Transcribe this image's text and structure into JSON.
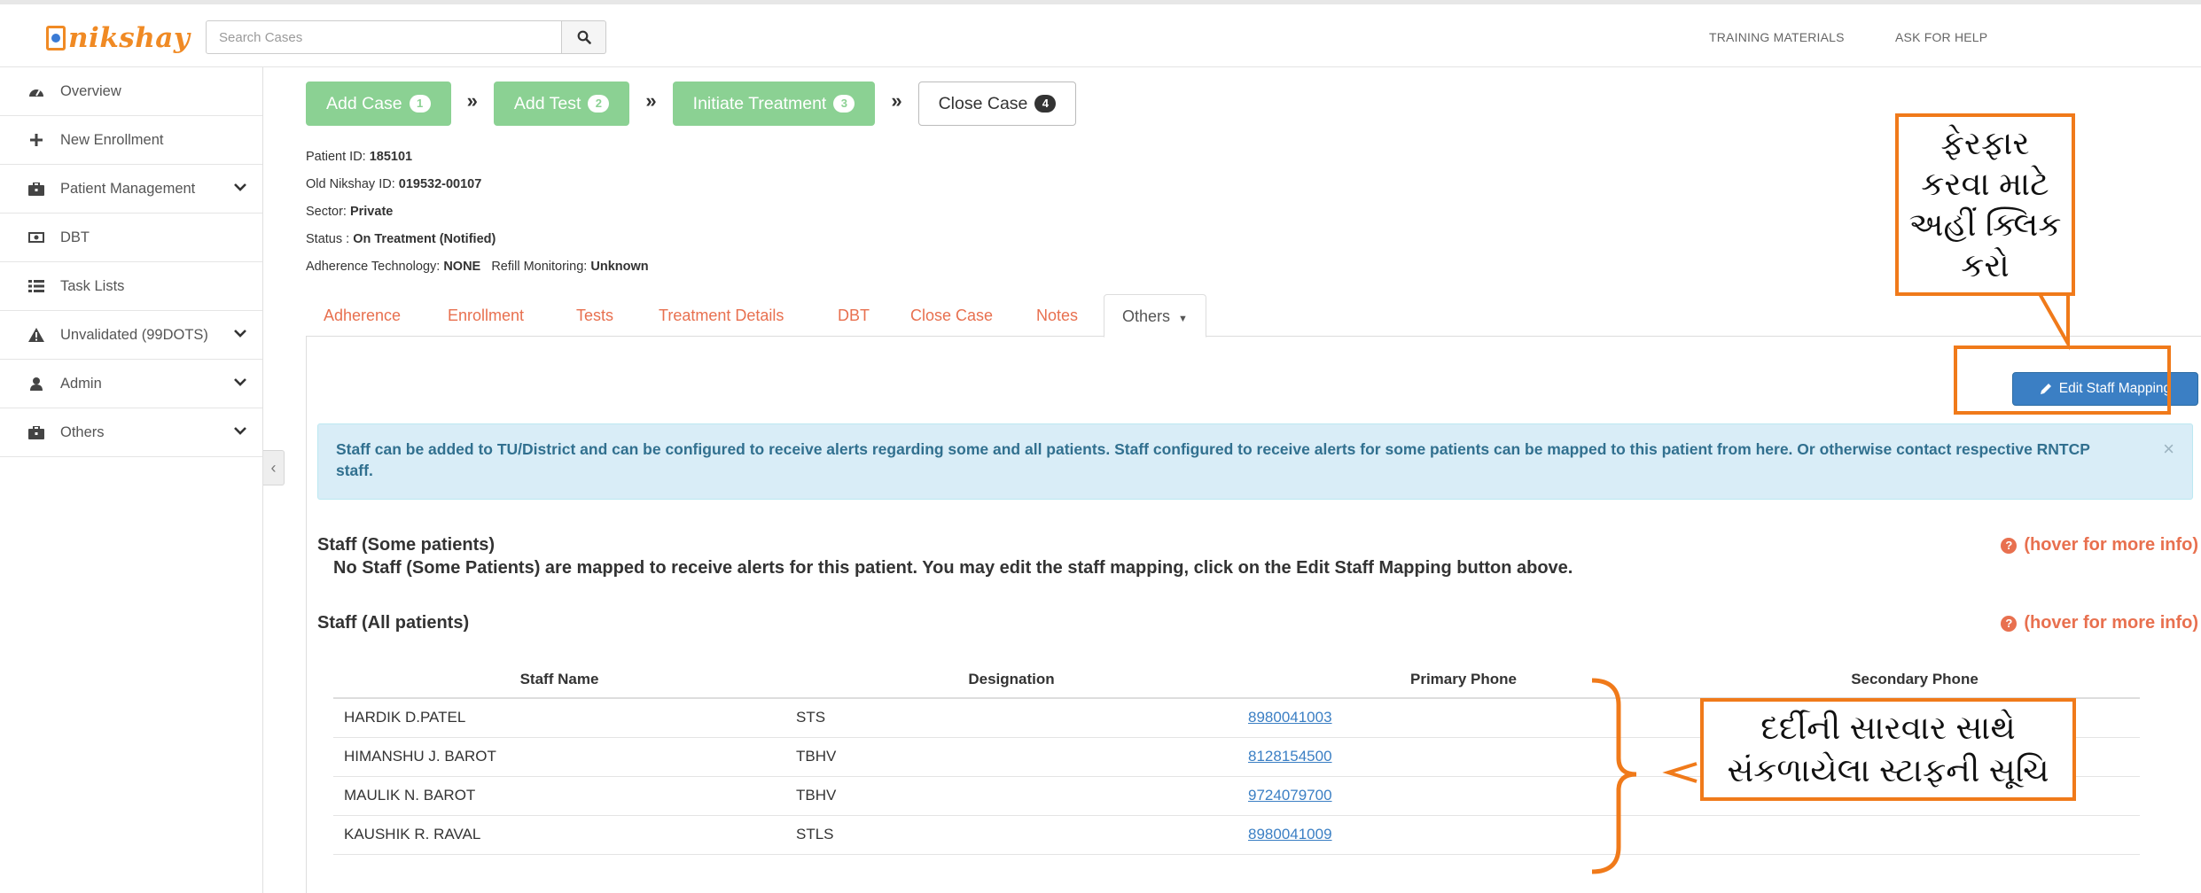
{
  "brand": {
    "logo_text": "nikshay"
  },
  "search": {
    "placeholder": "Search Cases"
  },
  "top_links": [
    "TRAINING MATERIALS",
    "ASK FOR HELP"
  ],
  "sidebar": {
    "items": [
      {
        "label": "Overview",
        "icon": "dashboard-icon"
      },
      {
        "label": "New Enrollment",
        "icon": "plus-icon"
      },
      {
        "label": "Patient Management",
        "icon": "briefcase-icon",
        "chevron": true
      },
      {
        "label": "DBT",
        "icon": "money-icon"
      },
      {
        "label": "Task Lists",
        "icon": "list-icon"
      },
      {
        "label": "Unvalidated (99DOTS)",
        "icon": "warning-icon",
        "chevron": true
      },
      {
        "label": "Admin",
        "icon": "user-icon",
        "chevron": true
      },
      {
        "label": "Others",
        "icon": "briefcase-icon",
        "chevron": true
      }
    ]
  },
  "steps": [
    {
      "label": "Add Case",
      "badge": "1",
      "state": "done"
    },
    {
      "label": "Add Test",
      "badge": "2",
      "state": "done"
    },
    {
      "label": "Initiate Treatment",
      "badge": "3",
      "state": "done"
    },
    {
      "label": "Close Case",
      "badge": "4",
      "state": "todo"
    }
  ],
  "patient": {
    "id_label": "Patient ID:",
    "id": "185101",
    "old_id_label": "Old Nikshay ID:",
    "old_id": "019532-00107",
    "sector_label": "Sector:",
    "sector": "Private",
    "status_label": "Status :",
    "status": "On Treatment (Notified)",
    "adherence_label": "Adherence Technology:",
    "adherence": "NONE",
    "refill_label": "Refill Monitoring:",
    "refill": "Unknown"
  },
  "tabs": [
    "Adherence",
    "Enrollment",
    "Tests",
    "Treatment Details",
    "DBT",
    "Close Case",
    "Notes",
    "Others"
  ],
  "active_tab": "Others",
  "edit_button": "Edit Staff Mapping",
  "alert_text": "Staff can be added to TU/District and can be configured to receive alerts regarding some and all patients. Staff configured to receive alerts for some patients can be mapped to this patient from here. Or otherwise contact respective RNTCP staff.",
  "alert_close": "×",
  "staff_some": {
    "title": "Staff (Some patients)",
    "hover": "(hover for more info)",
    "empty": "No Staff (Some Patients) are mapped to receive alerts for this patient. You may edit the staff mapping, click on the Edit Staff Mapping button above."
  },
  "staff_all": {
    "title": "Staff (All patients)",
    "hover": "(hover for more info)",
    "columns": [
      "Staff Name",
      "Designation",
      "Primary Phone",
      "Secondary Phone"
    ],
    "rows": [
      {
        "name": "HARDIK D.PATEL",
        "designation": "STS",
        "primary": "8980041003",
        "secondary": ""
      },
      {
        "name": "HIMANSHU J. BAROT",
        "designation": "TBHV",
        "primary": "8128154500",
        "secondary": ""
      },
      {
        "name": "MAULIK N. BAROT",
        "designation": "TBHV",
        "primary": "9724079700",
        "secondary": ""
      },
      {
        "name": "KAUSHIK R. RAVAL",
        "designation": "STLS",
        "primary": "8980041009",
        "secondary": ""
      }
    ]
  },
  "annotations": {
    "top_callout": [
      "ફેરફાર",
      "કરવા માટે",
      "અહીં ક્લિક",
      "કરો"
    ],
    "right_callout": [
      "દર્દીની સારવાર સાથે",
      "સંકળાયેલા સ્ટાફની સૂચિ"
    ],
    "color": "#f07a1a"
  },
  "colors": {
    "accent": "#e8704f",
    "step_done": "#8bd193",
    "button": "#3b7fc4",
    "alert_bg": "#d9edf7"
  }
}
